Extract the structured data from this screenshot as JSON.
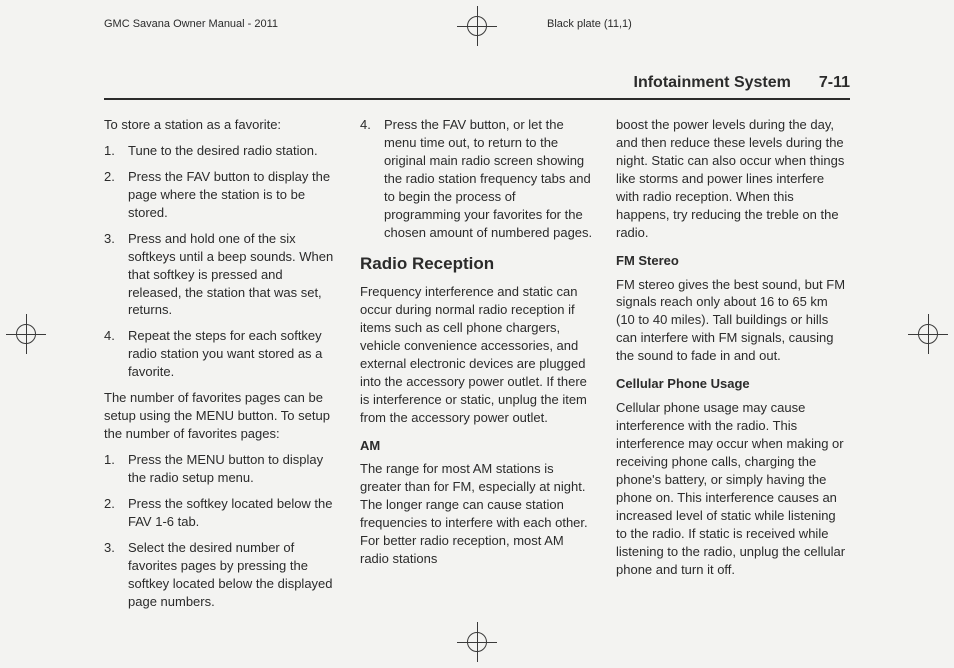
{
  "header": {
    "manual": "GMC Savana Owner Manual - 2011",
    "plate": "Black plate (11,1)"
  },
  "section": {
    "title": "Infotainment System",
    "page": "7-11"
  },
  "col1": {
    "intro": "To store a station as a favorite:",
    "steps1": [
      "Tune to the desired radio station.",
      "Press the FAV button to display the page where the station is to be stored.",
      "Press and hold one of the six softkeys until a beep sounds. When that softkey is pressed and released, the station that was set, returns.",
      "Repeat the steps for each softkey radio station you want stored as a favorite."
    ],
    "para2": "The number of favorites pages can be setup using the MENU button. To setup the number of favorites pages:",
    "steps2": [
      "Press the MENU button to display the radio setup menu.",
      "Press the softkey located below the FAV 1-6 tab.",
      "Select the desired number of favorites pages by pressing the softkey located below the displayed page numbers."
    ]
  },
  "col2": {
    "step4": "Press the FAV button, or let the menu time out, to return to the original main radio screen showing the radio station frequency tabs and to begin the process of programming your favorites for the chosen amount of numbered pages.",
    "h2": "Radio Reception",
    "para1": "Frequency interference and static can occur during normal radio reception if items such as cell phone chargers, vehicle convenience accessories, and external electronic devices are plugged into the accessory power outlet. If there is interference or static, unplug the item from the accessory power outlet.",
    "h3am": "AM",
    "am": "The range for most AM stations is greater than for FM, especially at night. The longer range can cause station frequencies to interfere with each other. For better radio reception, most AM radio stations"
  },
  "col3": {
    "amCont": "boost the power levels during the day, and then reduce these levels during the night. Static can also occur when things like storms and power lines interfere with radio reception. When this happens, try reducing the treble on the radio.",
    "h3fm": "FM Stereo",
    "fm": "FM stereo gives the best sound, but FM signals reach only about 16 to 65 km (10 to 40 miles). Tall buildings or hills can interfere with FM signals, causing the sound to fade in and out.",
    "h3cell": "Cellular Phone Usage",
    "cell": "Cellular phone usage may cause interference with the radio. This interference may occur when making or receiving phone calls, charging the phone's battery, or simply having the phone on. This interference causes an increased level of static while listening to the radio. If static is received while listening to the radio, unplug the cellular phone and turn it off."
  }
}
